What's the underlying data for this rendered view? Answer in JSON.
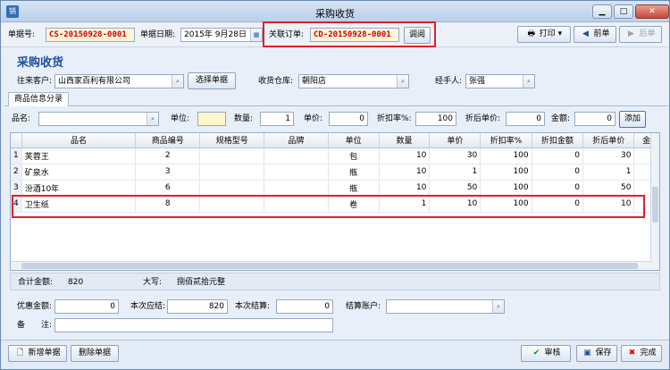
{
  "window": {
    "title": "采购收货",
    "icon_text": "销"
  },
  "header": {
    "doc_no_label": "单据号:",
    "doc_no": "CS-20150928-0001",
    "date_label": "单据日期:",
    "date": "2015年 9月28日",
    "order_label": "关联订单:",
    "order_no": "CD-20150928-0001",
    "order_btn": "调阅",
    "print_btn": "打印",
    "prev_btn": "前单",
    "next_btn": "后单"
  },
  "section_title": "采购收货",
  "form": {
    "customer_label": "往来客户:",
    "customer": "山西家百利有限公司",
    "select_btn": "选择单据",
    "warehouse_label": "收货仓库:",
    "warehouse": "朝阳店",
    "handler_label": "经手人:",
    "handler": "张强"
  },
  "tab": {
    "label": "商品信息分录"
  },
  "entry": {
    "name_label": "品名:",
    "name": "",
    "unit_label": "单位:",
    "unit": "",
    "qty_label": "数量:",
    "qty": "1",
    "price_label": "单价:",
    "price": "0",
    "discount_label": "折扣率%:",
    "discount": "100",
    "disc_price_label": "折后单价:",
    "disc_price": "0",
    "amount_label": "金额:",
    "amount": "0",
    "add_btn": "添加"
  },
  "table": {
    "columns": [
      "",
      "品名",
      "商品编号",
      "规格型号",
      "品牌",
      "单位",
      "数量",
      "单价",
      "折扣率%",
      "折扣金额",
      "折后单价",
      "金"
    ],
    "rows": [
      [
        "1",
        "芙蓉王",
        "2",
        "",
        "",
        "包",
        "10",
        "30",
        "100",
        "0",
        "30"
      ],
      [
        "2",
        "矿泉水",
        "3",
        "",
        "",
        "瓶",
        "10",
        "1",
        "100",
        "0",
        "1"
      ],
      [
        "3",
        "汾酒10年",
        "6",
        "",
        "",
        "瓶",
        "10",
        "50",
        "100",
        "0",
        "50"
      ],
      [
        "4",
        "卫生纸",
        "8",
        "",
        "",
        "卷",
        "1",
        "10",
        "100",
        "0",
        "10"
      ]
    ]
  },
  "summary": {
    "total_label": "合计金额:",
    "total": "820",
    "upper_label": "大写:",
    "upper": "捌佰贰拾元整"
  },
  "payment": {
    "discount_label": "优惠金额:",
    "discount": "0",
    "due_label": "本次应结:",
    "due": "820",
    "settle_label": "本次结算:",
    "settle": "0",
    "account_label": "结算账户:",
    "account": "",
    "note_label": "备　　注:",
    "note": ""
  },
  "bottom": {
    "new_btn": "新增单据",
    "delete_btn": "删除单据",
    "audit_btn": "审核",
    "save_btn": "保存",
    "done_btn": "完成"
  },
  "colors": {
    "accent": "#1f4fa0",
    "doc_no": "#d40000",
    "highlight": "#e0202a"
  }
}
